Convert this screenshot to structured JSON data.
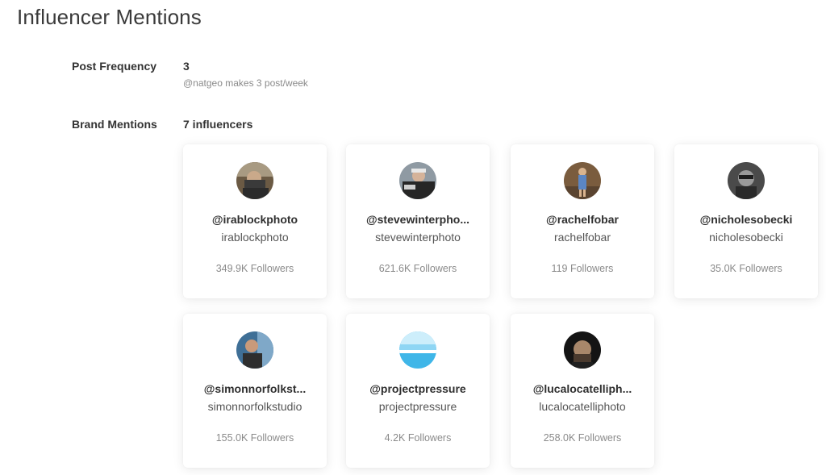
{
  "page": {
    "title": "Influencer Mentions"
  },
  "post_frequency": {
    "label": "Post Frequency",
    "value": "3",
    "subtext": "@natgeo makes 3 post/week"
  },
  "brand_mentions": {
    "label": "Brand Mentions",
    "value": "7 influencers"
  },
  "influencers": [
    {
      "handle": "@irablockphoto",
      "username": "irablockphoto",
      "followers": "349.9K Followers",
      "avatar": "photo-avatar"
    },
    {
      "handle": "@stevewinterpho...",
      "username": "stevewinterphoto",
      "followers": "621.6K Followers",
      "avatar": "photo-avatar"
    },
    {
      "handle": "@rachelfobar",
      "username": "rachelfobar",
      "followers": "119 Followers",
      "avatar": "photo-avatar"
    },
    {
      "handle": "@nicholesobecki",
      "username": "nicholesobecki",
      "followers": "35.0K Followers",
      "avatar": "photo-avatar"
    },
    {
      "handle": "@simonnorfolkst...",
      "username": "simonnorfolkstudio",
      "followers": "155.0K Followers",
      "avatar": "photo-avatar"
    },
    {
      "handle": "@projectpressure",
      "username": "projectpressure",
      "followers": "4.2K Followers",
      "avatar": "logo-avatar"
    },
    {
      "handle": "@lucalocatelliph...",
      "username": "lucalocatelliphoto",
      "followers": "258.0K Followers",
      "avatar": "photo-avatar"
    }
  ],
  "colors": {
    "card_background": "#ffffff",
    "muted_text": "#8a8a8a",
    "heading_text": "#3a3a3a",
    "project_pressure_blue": "#3fb6e8"
  }
}
